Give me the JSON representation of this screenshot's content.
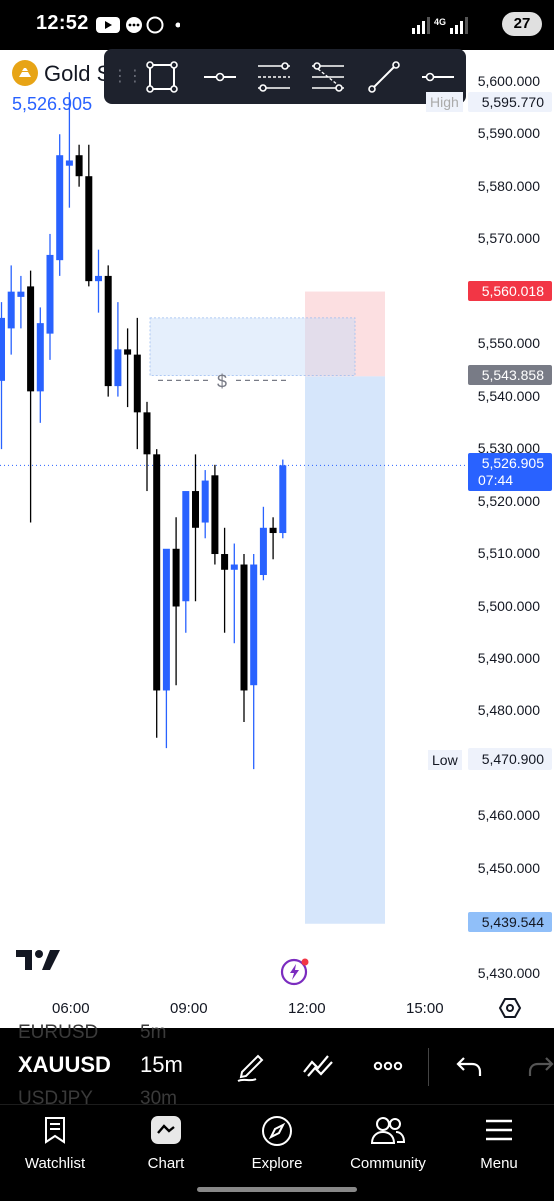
{
  "status_bar": {
    "time": "12:52",
    "network_label": "4G",
    "battery": "27",
    "icons": [
      "youtube-icon",
      "chat-icon",
      "whatsapp-icon",
      "dot-icon",
      "signal-icon",
      "battery-icon"
    ]
  },
  "header": {
    "symbol_name": "Gold S",
    "last_price": "5,526.905"
  },
  "drawing_toolbar": {
    "tools": [
      "rectangle-icon",
      "horizontal-ray-icon",
      "fib-retracement-icon",
      "long-position-icon",
      "trend-line-icon",
      "horizontal-line-icon"
    ]
  },
  "chart_data": {
    "type": "candlestick",
    "instrument": "XAUUSD",
    "interval": "15m",
    "price_axis": {
      "ticks": [
        "5,600.000",
        "5,590.000",
        "5,580.000",
        "5,570.000",
        "5,550.000",
        "5,540.000",
        "5,530.000",
        "5,520.000",
        "5,510.000",
        "5,500.000",
        "5,490.000",
        "5,480.000",
        "5,460.000",
        "5,450.000",
        "5,430.000"
      ],
      "ylim": [
        5428,
        5602
      ]
    },
    "time_axis": {
      "ticks": [
        "06:00",
        "09:00",
        "12:00",
        "15:00"
      ]
    },
    "high": {
      "label": "High",
      "value": "5,595.770"
    },
    "low": {
      "label": "Low",
      "value": "5,470.900"
    },
    "current_price": {
      "value": "5,526.905",
      "countdown": "07:44",
      "color": "#2962ff"
    },
    "stop_loss_price": {
      "value": "5,560.018",
      "color": "#f23645"
    },
    "entry_price": {
      "value": "5,543.858",
      "color": "#787b86"
    },
    "target_price": {
      "value": "5,439.544",
      "color": "#90bff9"
    },
    "position_tool": {
      "type": "short",
      "entry": 5543.858,
      "stop": 5560.018,
      "target": 5439.544
    },
    "zone": {
      "top": 5555,
      "bottom": 5544,
      "marker": "$"
    },
    "candles": [
      {
        "o": 5543,
        "h": 5558,
        "l": 5530,
        "c": 5555
      },
      {
        "o": 5553,
        "h": 5565,
        "l": 5548,
        "c": 5560
      },
      {
        "o": 5559,
        "h": 5563,
        "l": 5553,
        "c": 5560
      },
      {
        "o": 5561,
        "h": 5564,
        "l": 5516,
        "c": 5541
      },
      {
        "o": 5541,
        "h": 5557,
        "l": 5535,
        "c": 5554
      },
      {
        "o": 5552,
        "h": 5571,
        "l": 5547,
        "c": 5567
      },
      {
        "o": 5566,
        "h": 5590,
        "l": 5563,
        "c": 5586
      },
      {
        "o": 5584,
        "h": 5598,
        "l": 5576,
        "c": 5585
      },
      {
        "o": 5586,
        "h": 5588,
        "l": 5580,
        "c": 5582
      },
      {
        "o": 5582,
        "h": 5588,
        "l": 5561,
        "c": 5562
      },
      {
        "o": 5562,
        "h": 5568,
        "l": 5556,
        "c": 5563
      },
      {
        "o": 5563,
        "h": 5565,
        "l": 5540,
        "c": 5542
      },
      {
        "o": 5542,
        "h": 5558,
        "l": 5540,
        "c": 5549
      },
      {
        "o": 5549,
        "h": 5553,
        "l": 5538,
        "c": 5548
      },
      {
        "o": 5548,
        "h": 5555,
        "l": 5530,
        "c": 5537
      },
      {
        "o": 5537,
        "h": 5539,
        "l": 5522,
        "c": 5529
      },
      {
        "o": 5529,
        "h": 5530,
        "l": 5475,
        "c": 5484
      },
      {
        "o": 5484,
        "h": 5510,
        "l": 5473,
        "c": 5511
      },
      {
        "o": 5511,
        "h": 5517,
        "l": 5485,
        "c": 5500
      },
      {
        "o": 5501,
        "h": 5520,
        "l": 5495,
        "c": 5522
      },
      {
        "o": 5522,
        "h": 5529,
        "l": 5501,
        "c": 5515
      },
      {
        "o": 5516,
        "h": 5526,
        "l": 5513,
        "c": 5524
      },
      {
        "o": 5525,
        "h": 5527,
        "l": 5508,
        "c": 5510
      },
      {
        "o": 5510,
        "h": 5515,
        "l": 5495,
        "c": 5507
      },
      {
        "o": 5507,
        "h": 5512,
        "l": 5493,
        "c": 5508
      },
      {
        "o": 5508,
        "h": 5510,
        "l": 5478,
        "c": 5484
      },
      {
        "o": 5485,
        "h": 5510,
        "l": 5469,
        "c": 5508
      },
      {
        "o": 5506,
        "h": 5519,
        "l": 5505,
        "c": 5515
      },
      {
        "o": 5515,
        "h": 5517,
        "l": 5509,
        "c": 5514
      },
      {
        "o": 5514,
        "h": 5528,
        "l": 5513,
        "c": 5526.905
      }
    ],
    "colors": {
      "up": "#2962ff",
      "down": "#000000"
    }
  },
  "bottom_toolbar": {
    "symbol": "XAUUSD",
    "interval": "15m",
    "ghost_symbols": [
      "EURUSD",
      "USDJPY"
    ],
    "ghost_intervals": [
      "5m",
      "30m"
    ],
    "icons": [
      "pencil-icon",
      "indicators-icon",
      "more-icon",
      "undo-icon",
      "redo-icon"
    ]
  },
  "nav": {
    "items": [
      {
        "label": "Watchlist",
        "icon": "watchlist-icon"
      },
      {
        "label": "Chart",
        "icon": "chart-icon"
      },
      {
        "label": "Explore",
        "icon": "compass-icon"
      },
      {
        "label": "Community",
        "icon": "community-icon"
      },
      {
        "label": "Menu",
        "icon": "menu-icon"
      }
    ]
  }
}
